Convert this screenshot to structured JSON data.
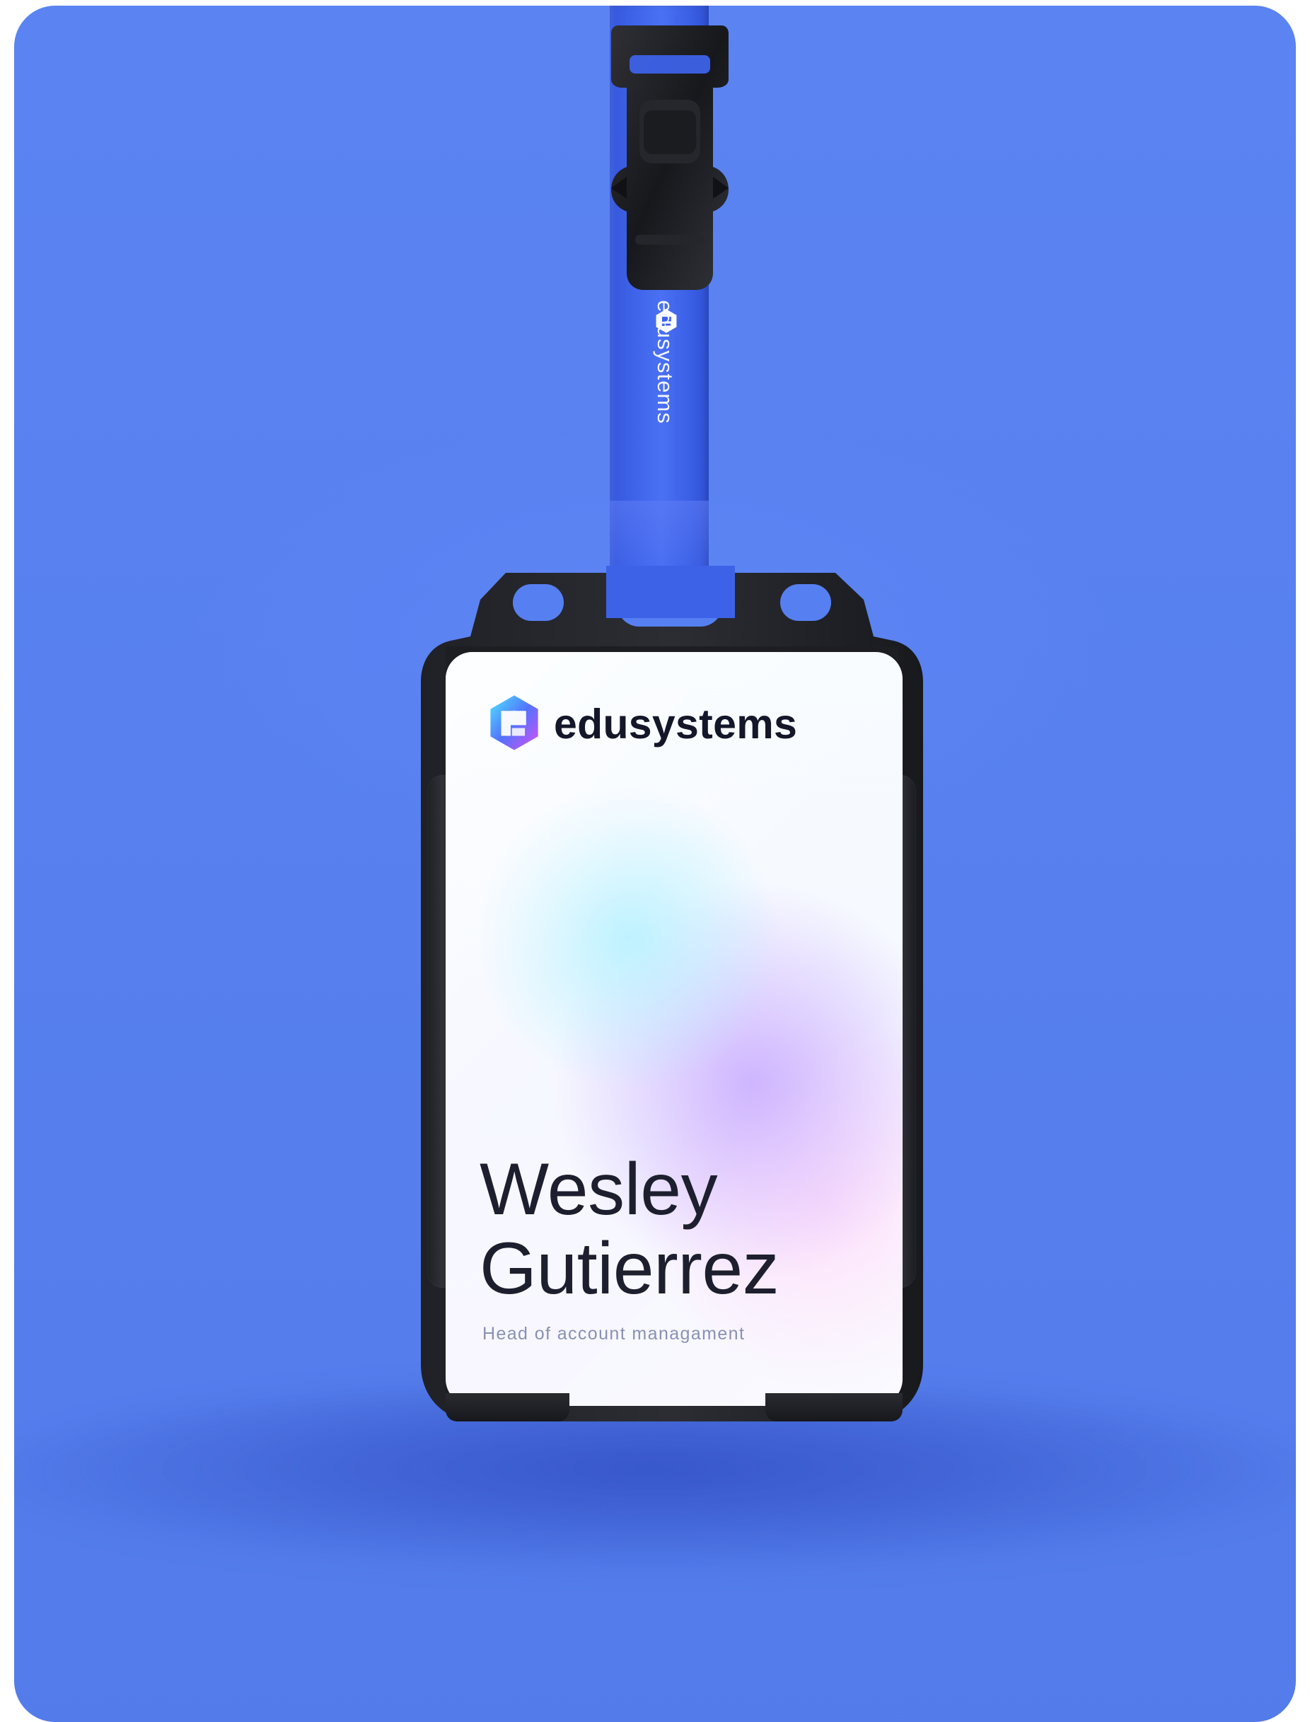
{
  "strap": {
    "brand_text": "edusystems",
    "logo_icon": "edusystems-logo-icon"
  },
  "badge": {
    "brand_text": "edusystems",
    "logo_icon": "edusystems-logo-icon",
    "first_name": "Wesley",
    "last_name": "Gutierrez",
    "role": "Head of account managament"
  },
  "colors": {
    "background": "#5680f2",
    "lanyard": "#3c62e8",
    "holder": "#1f2024"
  }
}
